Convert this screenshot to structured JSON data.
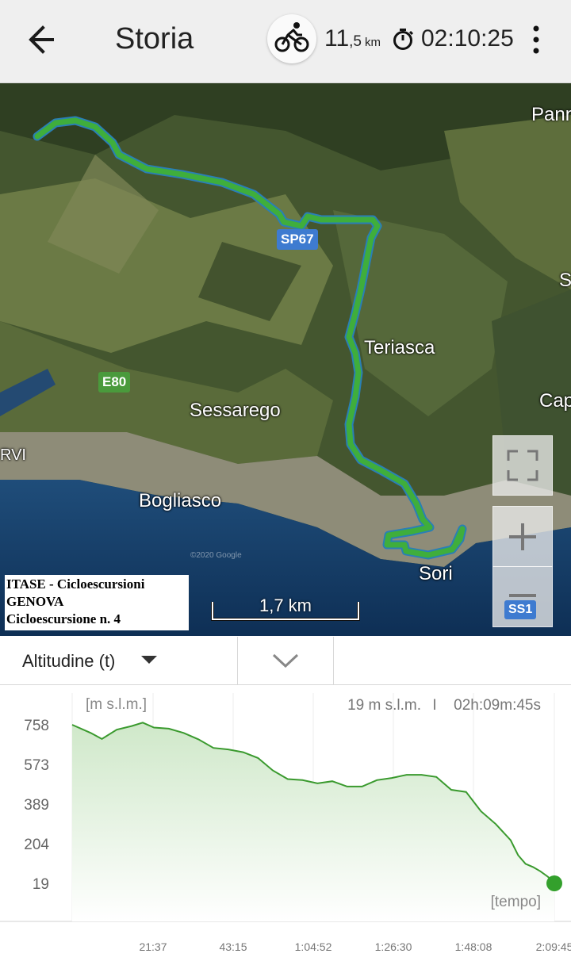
{
  "header": {
    "title": "Storia",
    "distance_main": "11",
    "distance_decimal": ",5",
    "distance_unit": "km",
    "duration": "02:10:25"
  },
  "map": {
    "places": [
      "Teriasca",
      "Sessarego",
      "Bogliasco",
      "Sori",
      "RVI",
      "Pann",
      "Cap",
      "S"
    ],
    "road_shields": [
      "SP67",
      "E80",
      "SS1"
    ],
    "scale_label": "1,7 km",
    "caption": [
      "ITASE - Cicloescursioni",
      "GENOVA",
      "Cicloescursione n. 4"
    ],
    "watermark": "©2020 Google"
  },
  "selector": {
    "metric": "Altitudine (t)"
  },
  "colors": {
    "track": "#3fae3c",
    "track_outline": "#2a7fb5",
    "profile_line": "#3a9a2e",
    "profile_fill_top": "#cfe8c9"
  },
  "chart_data": {
    "type": "area",
    "ylabel": "[m s.l.m.]",
    "xlabel": "[tempo]",
    "readout_altitude": "19 m s.l.m.",
    "readout_separator": "I",
    "readout_time": "02h:09m:45s",
    "ytick_labels": [
      "758",
      "573",
      "389",
      "204",
      "19"
    ],
    "yticks": [
      758,
      573,
      389,
      204,
      19
    ],
    "ylim": [
      19,
      758
    ],
    "xtick_labels": [
      "21:37",
      "43:15",
      "1:04:52",
      "1:26:30",
      "1:48:08",
      "2:09:45"
    ],
    "x_minutes": [
      0,
      5,
      8,
      12,
      16,
      19,
      22,
      26,
      30,
      34,
      38,
      42,
      46,
      50,
      54,
      58,
      62,
      66,
      70,
      74,
      78,
      82,
      86,
      90,
      94,
      98,
      102,
      106,
      110,
      114,
      118,
      120,
      122,
      124,
      126,
      128,
      129.75
    ],
    "altitude_m": [
      758,
      720,
      692,
      735,
      752,
      768,
      745,
      740,
      720,
      690,
      650,
      643,
      630,
      603,
      545,
      505,
      500,
      485,
      495,
      470,
      470,
      500,
      510,
      525,
      525,
      515,
      455,
      445,
      355,
      295,
      220,
      150,
      110,
      95,
      75,
      50,
      19
    ],
    "grid": true,
    "legend": "none"
  }
}
